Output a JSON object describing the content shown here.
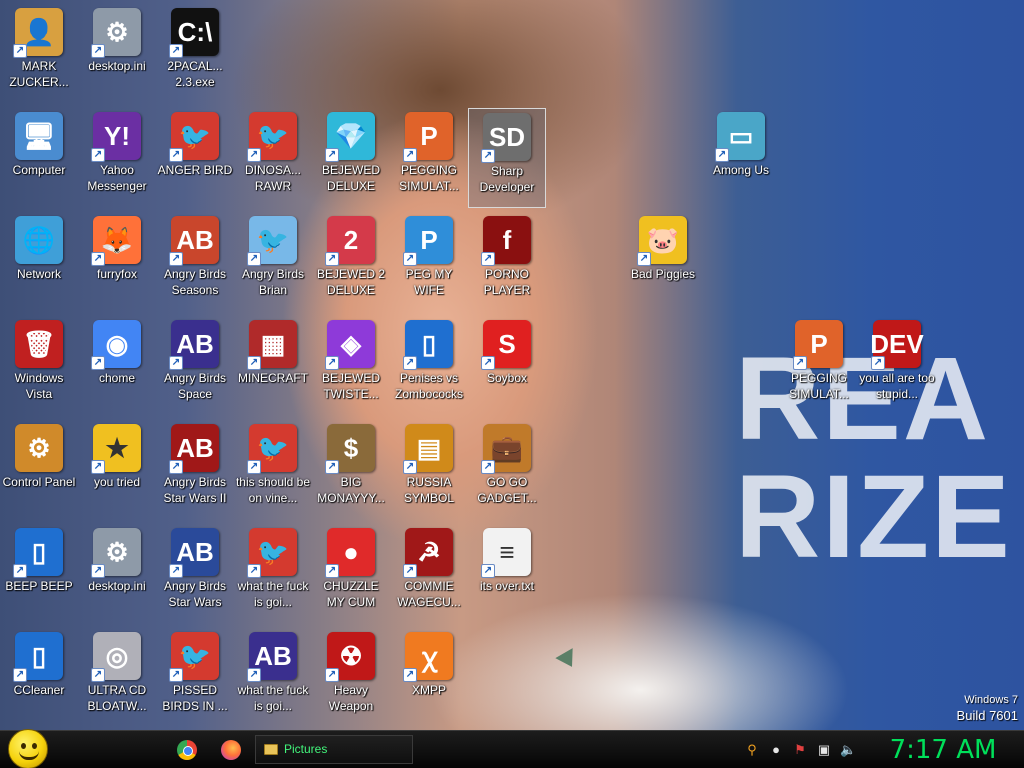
{
  "desktop": {
    "wallpaper_text": "REA\nRIZE",
    "watermark": {
      "edition": "Windows 7",
      "build": "Build 7601"
    },
    "icons": [
      {
        "label": "MARK ZUCKER...",
        "icon": "user-folder-icon",
        "color": "#d8a040",
        "glyph": "👤"
      },
      {
        "label": "desktop.ini",
        "icon": "settings-file-icon",
        "color": "#8e9aa8",
        "glyph": "⚙"
      },
      {
        "label": "2PACAL... 2.3.exe",
        "icon": "console-icon",
        "color": "#111111",
        "glyph": "C:\\"
      },
      {
        "label": "Computer",
        "icon": "computer-icon",
        "color": "#4a8cd0",
        "glyph": "🖥"
      },
      {
        "label": "Yahoo Messenger",
        "icon": "yahoo-messenger-icon",
        "color": "#6b2fa3",
        "glyph": "Y!"
      },
      {
        "label": "ANGER BIRD",
        "icon": "angry-bird-icon",
        "color": "#d43a2f",
        "glyph": "🐦"
      },
      {
        "label": "DINOSA... RAWR",
        "icon": "angry-bird-icon",
        "color": "#d43a2f",
        "glyph": "🐦"
      },
      {
        "label": "BEJEWED DELUXE",
        "icon": "gem-icon",
        "color": "#2fb8d9",
        "glyph": "💎"
      },
      {
        "label": "PEGGING SIMULAT...",
        "icon": "peggle-icon",
        "color": "#e0632a",
        "glyph": "P"
      },
      {
        "label": "Sharp Developer",
        "icon": "sharpdevelop-icon",
        "color": "#6e6e6e",
        "glyph": "SD"
      },
      {
        "label": "Among Us",
        "icon": "among-us-icon",
        "color": "#4aa6c8",
        "glyph": "▭"
      },
      {
        "label": "Network",
        "icon": "network-icon",
        "color": "#3f9fd8",
        "glyph": "🌐"
      },
      {
        "label": "furryfox",
        "icon": "firefox-icon",
        "color": "#ff7139",
        "glyph": "🦊"
      },
      {
        "label": "Angry Birds Seasons",
        "icon": "angry-birds-seasons-icon",
        "color": "#c9462c",
        "glyph": "AB"
      },
      {
        "label": "Angry Birds Brian",
        "icon": "angry-birds-brian-icon",
        "color": "#78b8e8",
        "glyph": "🐦"
      },
      {
        "label": "BEJEWED 2 DELUXE",
        "icon": "gem-icon",
        "color": "#d43a4a",
        "glyph": "2"
      },
      {
        "label": "PEG MY WIFE",
        "icon": "peggle-icon",
        "color": "#2f8ed9",
        "glyph": "P"
      },
      {
        "label": "PORNO PLAYER",
        "icon": "flash-icon",
        "color": "#8a1010",
        "glyph": "f"
      },
      {
        "label": "Bad Piggies",
        "icon": "bad-piggies-icon",
        "color": "#f0c020",
        "glyph": "🐷"
      },
      {
        "label": "Windows Vista",
        "icon": "recycle-bin-icon",
        "color": "#c02020",
        "glyph": "🗑"
      },
      {
        "label": "chome",
        "icon": "chrome-icon",
        "color": "#4285f4",
        "glyph": "◉"
      },
      {
        "label": "Angry Birds Space",
        "icon": "angry-birds-space-icon",
        "color": "#3a2f8e",
        "glyph": "AB"
      },
      {
        "label": "MINECRAFT",
        "icon": "minecraft-icon",
        "color": "#b02a2a",
        "glyph": "▦"
      },
      {
        "label": "BEJEWED TWISTE...",
        "icon": "gem-icon",
        "color": "#8e3ad9",
        "glyph": "◈"
      },
      {
        "label": "Penises vs Zombococks",
        "icon": "plants-vs-zombies-icon",
        "color": "#1f6fd0",
        "glyph": "▯"
      },
      {
        "label": "Soybox",
        "icon": "soybox-icon",
        "color": "#e02020",
        "glyph": "S"
      },
      {
        "label": "PEGGING SIMULAT...",
        "icon": "peggle-icon",
        "color": "#e0632a",
        "glyph": "P"
      },
      {
        "label": "you all are too stupid...",
        "icon": "dev-cpp-icon",
        "color": "#c01818",
        "glyph": "DEV"
      },
      {
        "label": "Control Panel",
        "icon": "control-panel-icon",
        "color": "#d08a2a",
        "glyph": "⚙"
      },
      {
        "label": "you tried",
        "icon": "star-icon",
        "color": "#f0c020",
        "glyph": "★"
      },
      {
        "label": "Angry Birds Star Wars II",
        "icon": "angry-birds-star-wars-icon",
        "color": "#a01818",
        "glyph": "AB"
      },
      {
        "label": "this should be on vine...",
        "icon": "angry-bird-icon",
        "color": "#d43a2f",
        "glyph": "🐦"
      },
      {
        "label": "BIG MONAYYY...",
        "icon": "money-bag-icon",
        "color": "#8a6a3a",
        "glyph": "$"
      },
      {
        "label": "RUSSIA SYMBOL",
        "icon": "gold-blocks-icon",
        "color": "#d08a1a",
        "glyph": "▤"
      },
      {
        "label": "GO GO GADGET...",
        "icon": "briefcase-icon",
        "color": "#c07a2a",
        "glyph": "💼"
      },
      {
        "label": "BEEP BEEP",
        "icon": "blue-shortcut-icon",
        "color": "#1f6fd0",
        "glyph": "▯"
      },
      {
        "label": "desktop.ini",
        "icon": "settings-file-icon",
        "color": "#8e9aa8",
        "glyph": "⚙"
      },
      {
        "label": "Angry Birds Star Wars",
        "icon": "angry-birds-star-wars-icon",
        "color": "#2a4a9a",
        "glyph": "AB"
      },
      {
        "label": "what the fuck is goi...",
        "icon": "angry-bird-icon",
        "color": "#d43a2f",
        "glyph": "🐦"
      },
      {
        "label": "CHUZZLE MY CUM",
        "icon": "chuzzle-icon",
        "color": "#e02a2a",
        "glyph": "●"
      },
      {
        "label": "COMMIE WAGECU...",
        "icon": "commie-flag-icon",
        "color": "#a01818",
        "glyph": "☭"
      },
      {
        "label": "its over.txt",
        "icon": "text-file-icon",
        "color": "#f2f2f2",
        "glyph": "≡"
      },
      {
        "label": "CCleaner",
        "icon": "ccleaner-icon",
        "color": "#1f6fd0",
        "glyph": "▯"
      },
      {
        "label": "ULTRA CD BLOATW...",
        "icon": "cd-icon",
        "color": "#b0b0b8",
        "glyph": "◎"
      },
      {
        "label": "PISSED BIRDS IN ...",
        "icon": "angry-bird-icon",
        "color": "#d43a2f",
        "glyph": "🐦"
      },
      {
        "label": "what the fuck is goi...",
        "icon": "angry-birds-space-icon",
        "color": "#3a2f8e",
        "glyph": "AB"
      },
      {
        "label": "Heavy Weapon",
        "icon": "heavy-weapon-icon",
        "color": "#c01818",
        "glyph": "☢"
      },
      {
        "label": "XMPP",
        "icon": "xampp-icon",
        "color": "#f07a20",
        "glyph": "ꭓ"
      }
    ]
  },
  "taskbar": {
    "pinned": [
      {
        "name": "Chrome",
        "icon": "chrome-icon"
      },
      {
        "name": "Firefox",
        "icon": "firefox-icon"
      }
    ],
    "window_label": "Pictures",
    "tray_icons": [
      "search-icon",
      "chat-icon",
      "action-center-flag-icon",
      "network-icon",
      "volume-icon"
    ],
    "clock": "7:17 AM",
    "clock_color": "#00e05a"
  }
}
